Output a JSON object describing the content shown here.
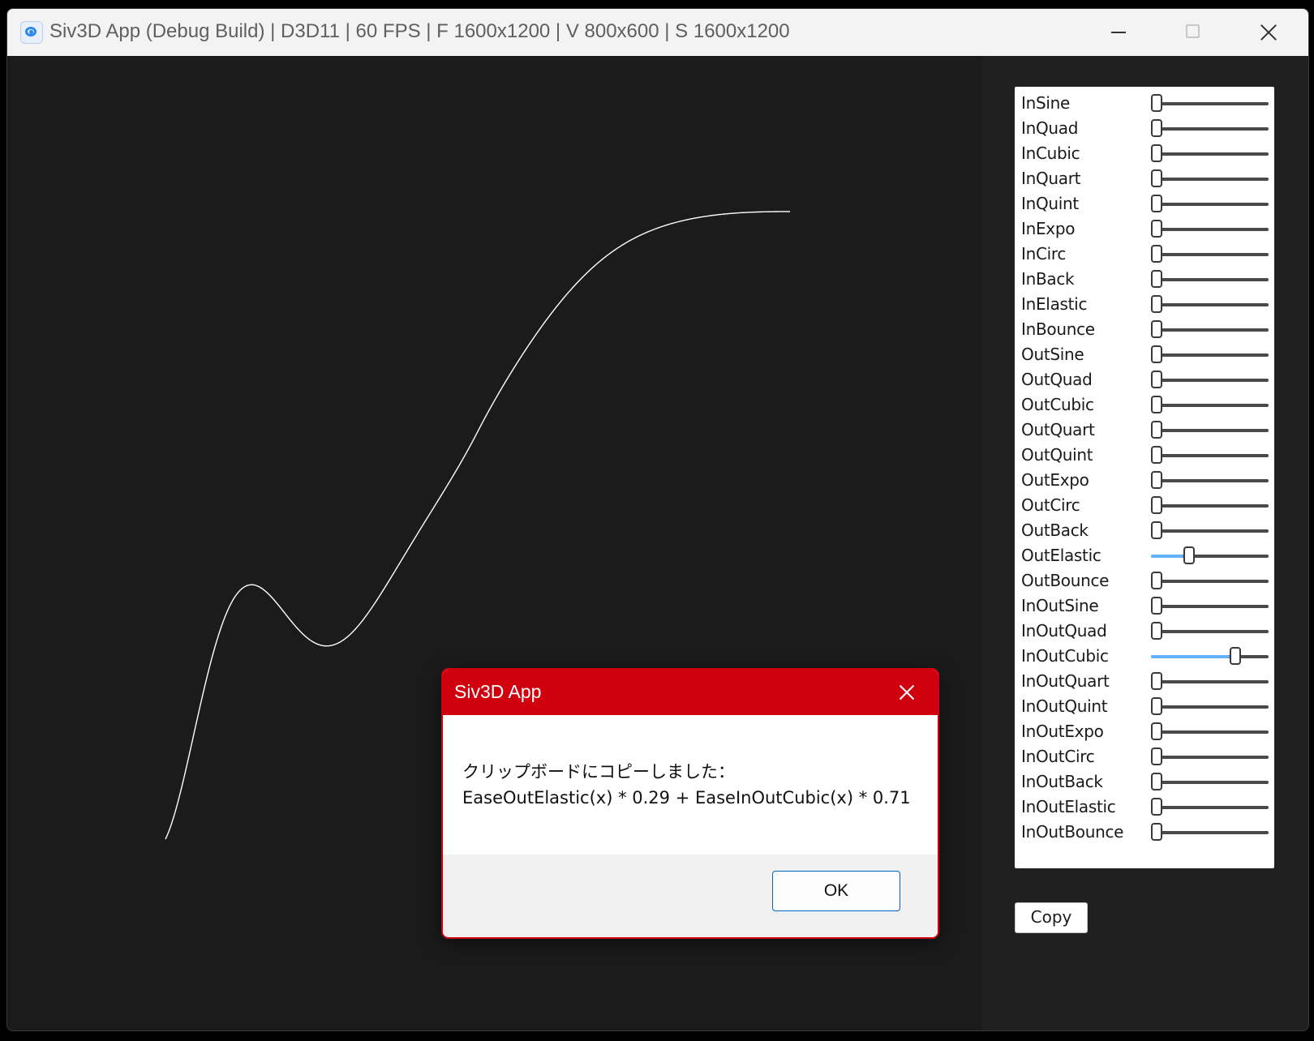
{
  "window": {
    "title": "Siv3D App (Debug Build) | D3D11 | 60 FPS | F 1600x1200 | V 800x600 | S 1600x1200"
  },
  "curve": {
    "color": "#ffffff",
    "weights": {
      "OutElastic": 0.29,
      "InOutCubic": 0.71
    }
  },
  "sliders": [
    {
      "label": "InSine",
      "value": 0.0
    },
    {
      "label": "InQuad",
      "value": 0.0
    },
    {
      "label": "InCubic",
      "value": 0.0
    },
    {
      "label": "InQuart",
      "value": 0.0
    },
    {
      "label": "InQuint",
      "value": 0.0
    },
    {
      "label": "InExpo",
      "value": 0.0
    },
    {
      "label": "InCirc",
      "value": 0.0
    },
    {
      "label": "InBack",
      "value": 0.0
    },
    {
      "label": "InElastic",
      "value": 0.0
    },
    {
      "label": "InBounce",
      "value": 0.0
    },
    {
      "label": "OutSine",
      "value": 0.0
    },
    {
      "label": "OutQuad",
      "value": 0.0
    },
    {
      "label": "OutCubic",
      "value": 0.0
    },
    {
      "label": "OutQuart",
      "value": 0.0
    },
    {
      "label": "OutQuint",
      "value": 0.0
    },
    {
      "label": "OutExpo",
      "value": 0.0
    },
    {
      "label": "OutCirc",
      "value": 0.0
    },
    {
      "label": "OutBack",
      "value": 0.0
    },
    {
      "label": "OutElastic",
      "value": 0.29
    },
    {
      "label": "OutBounce",
      "value": 0.0
    },
    {
      "label": "InOutSine",
      "value": 0.0
    },
    {
      "label": "InOutQuad",
      "value": 0.0
    },
    {
      "label": "InOutCubic",
      "value": 0.71
    },
    {
      "label": "InOutQuart",
      "value": 0.0
    },
    {
      "label": "InOutQuint",
      "value": 0.0
    },
    {
      "label": "InOutExpo",
      "value": 0.0
    },
    {
      "label": "InOutCirc",
      "value": 0.0
    },
    {
      "label": "InOutBack",
      "value": 0.0
    },
    {
      "label": "InOutElastic",
      "value": 0.0
    },
    {
      "label": "InOutBounce",
      "value": 0.0
    }
  ],
  "copy_button": {
    "label": "Copy"
  },
  "dialog": {
    "title": "Siv3D App",
    "message_line1": "クリップボードにコピーしました：",
    "message_line2": "EaseOutElastic(x) * 0.29 + EaseInOutCubic(x) * 0.71",
    "ok_label": "OK"
  },
  "colors": {
    "accent": "#63b3ff",
    "dialog_red": "#d0000f",
    "background": "#1b1b1b"
  }
}
